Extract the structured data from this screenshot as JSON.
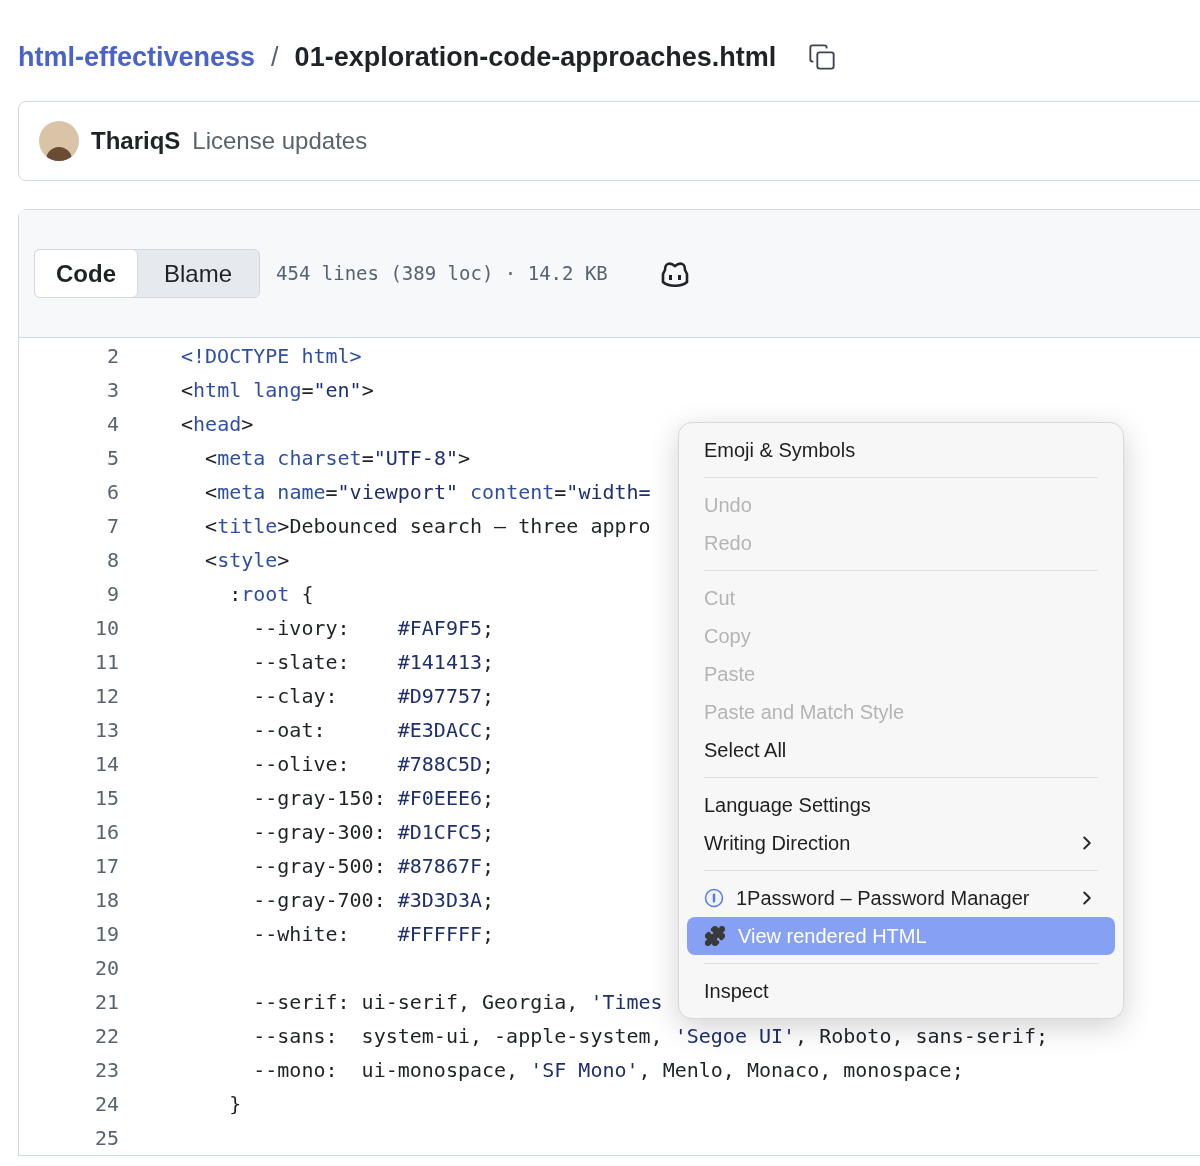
{
  "breadcrumb": {
    "repo": "html-effectiveness",
    "separator": "/",
    "file": "01-exploration-code-approaches.html"
  },
  "commit": {
    "author": "ThariqS",
    "message": "License updates"
  },
  "file_header": {
    "tabs": [
      {
        "label": "Code",
        "selected": true
      },
      {
        "label": "Blame",
        "selected": false
      }
    ],
    "info": "454 lines (389 loc) · 14.2 KB"
  },
  "code_lines": [
    {
      "number": "2",
      "tokens": [
        {
          "kind": "tag",
          "text": "<!DOCTYPE html>"
        }
      ]
    },
    {
      "number": "3",
      "tokens": [
        {
          "kind": "text",
          "text": "<"
        },
        {
          "kind": "tag",
          "text": "html"
        },
        {
          "kind": "attr",
          "text": " lang"
        },
        {
          "kind": "text",
          "text": "="
        },
        {
          "kind": "string",
          "text": "\"en\""
        },
        {
          "kind": "text",
          "text": ">"
        }
      ]
    },
    {
      "number": "4",
      "tokens": [
        {
          "kind": "text",
          "text": "<"
        },
        {
          "kind": "tag",
          "text": "head"
        },
        {
          "kind": "text",
          "text": ">"
        }
      ]
    },
    {
      "number": "5",
      "tokens": [
        {
          "kind": "text",
          "text": "  <"
        },
        {
          "kind": "tag",
          "text": "meta"
        },
        {
          "kind": "attr",
          "text": " charset"
        },
        {
          "kind": "text",
          "text": "="
        },
        {
          "kind": "string",
          "text": "\"UTF-8\""
        },
        {
          "kind": "text",
          "text": ">"
        }
      ]
    },
    {
      "number": "6",
      "tokens": [
        {
          "kind": "text",
          "text": "  <"
        },
        {
          "kind": "tag",
          "text": "meta"
        },
        {
          "kind": "attr",
          "text": " name"
        },
        {
          "kind": "text",
          "text": "="
        },
        {
          "kind": "string",
          "text": "\"viewport\""
        },
        {
          "kind": "attr",
          "text": " content"
        },
        {
          "kind": "text",
          "text": "="
        },
        {
          "kind": "string",
          "text": "\"width="
        }
      ]
    },
    {
      "number": "7",
      "tokens": [
        {
          "kind": "text",
          "text": "  <"
        },
        {
          "kind": "tag",
          "text": "title"
        },
        {
          "kind": "text",
          "text": ">Debounced search – three appro"
        }
      ]
    },
    {
      "number": "8",
      "tokens": [
        {
          "kind": "text",
          "text": "  <"
        },
        {
          "kind": "tag",
          "text": "style"
        },
        {
          "kind": "text",
          "text": ">"
        }
      ]
    },
    {
      "number": "9",
      "tokens": [
        {
          "kind": "text",
          "text": "    :"
        },
        {
          "kind": "tag",
          "text": "root"
        },
        {
          "kind": "text",
          "text": " {"
        }
      ]
    },
    {
      "number": "10",
      "tokens": [
        {
          "kind": "text",
          "text": "      --ivory:    "
        },
        {
          "kind": "string",
          "text": "#FAF9F5"
        },
        {
          "kind": "text",
          "text": ";"
        }
      ]
    },
    {
      "number": "11",
      "tokens": [
        {
          "kind": "text",
          "text": "      --slate:    "
        },
        {
          "kind": "string",
          "text": "#141413"
        },
        {
          "kind": "text",
          "text": ";"
        }
      ]
    },
    {
      "number": "12",
      "tokens": [
        {
          "kind": "text",
          "text": "      --clay:     "
        },
        {
          "kind": "string",
          "text": "#D97757"
        },
        {
          "kind": "text",
          "text": ";"
        }
      ]
    },
    {
      "number": "13",
      "tokens": [
        {
          "kind": "text",
          "text": "      --oat:      "
        },
        {
          "kind": "string",
          "text": "#E3DACC"
        },
        {
          "kind": "text",
          "text": ";"
        }
      ]
    },
    {
      "number": "14",
      "tokens": [
        {
          "kind": "text",
          "text": "      --olive:    "
        },
        {
          "kind": "string",
          "text": "#788C5D"
        },
        {
          "kind": "text",
          "text": ";"
        }
      ]
    },
    {
      "number": "15",
      "tokens": [
        {
          "kind": "text",
          "text": "      --gray-150: "
        },
        {
          "kind": "string",
          "text": "#F0EEE6"
        },
        {
          "kind": "text",
          "text": ";"
        }
      ]
    },
    {
      "number": "16",
      "tokens": [
        {
          "kind": "text",
          "text": "      --gray-300: "
        },
        {
          "kind": "string",
          "text": "#D1CFC5"
        },
        {
          "kind": "text",
          "text": ";"
        }
      ]
    },
    {
      "number": "17",
      "tokens": [
        {
          "kind": "text",
          "text": "      --gray-500: "
        },
        {
          "kind": "string",
          "text": "#87867F"
        },
        {
          "kind": "text",
          "text": ";"
        }
      ]
    },
    {
      "number": "18",
      "tokens": [
        {
          "kind": "text",
          "text": "      --gray-700: "
        },
        {
          "kind": "string",
          "text": "#3D3D3A"
        },
        {
          "kind": "text",
          "text": ";"
        }
      ]
    },
    {
      "number": "19",
      "tokens": [
        {
          "kind": "text",
          "text": "      --white:    "
        },
        {
          "kind": "string",
          "text": "#FFFFFF"
        },
        {
          "kind": "text",
          "text": ";"
        }
      ]
    },
    {
      "number": "20"
    },
    {
      "number": "21",
      "tokens": [
        {
          "kind": "text",
          "text": "      --serif: ui-serif, Georgia, "
        },
        {
          "kind": "string",
          "text": "'Times"
        }
      ]
    },
    {
      "number": "22",
      "tokens": [
        {
          "kind": "text",
          "text": "      --sans:  system-ui, -apple-system, "
        },
        {
          "kind": "string",
          "text": "'Segoe UI'"
        },
        {
          "kind": "text",
          "text": ", Roboto, sans-serif;"
        }
      ]
    },
    {
      "number": "23",
      "tokens": [
        {
          "kind": "text",
          "text": "      --mono:  ui-monospace, "
        },
        {
          "kind": "string",
          "text": "'SF Mono'"
        },
        {
          "kind": "text",
          "text": ", Menlo, Monaco, monospace;"
        }
      ]
    },
    {
      "number": "24",
      "tokens": [
        {
          "kind": "text",
          "text": "    }"
        }
      ]
    },
    {
      "number": "25"
    }
  ],
  "context_menu": {
    "groups": [
      [
        {
          "label": "Emoji & Symbols",
          "kind": "text",
          "disabled": false,
          "selected": false,
          "submenu": false
        }
      ],
      [
        {
          "label": "Undo",
          "kind": "text",
          "disabled": true,
          "selected": false,
          "submenu": false
        },
        {
          "label": "Redo",
          "kind": "text",
          "disabled": true,
          "selected": false,
          "submenu": false
        }
      ],
      [
        {
          "label": "Cut",
          "kind": "text",
          "disabled": true,
          "selected": false,
          "submenu": false
        },
        {
          "label": "Copy",
          "kind": "text",
          "disabled": true,
          "selected": false,
          "submenu": false
        },
        {
          "label": "Paste",
          "kind": "text",
          "disabled": true,
          "selected": false,
          "submenu": false
        },
        {
          "label": "Paste and Match Style",
          "kind": "text",
          "disabled": true,
          "selected": false,
          "submenu": false
        },
        {
          "label": "Select All",
          "kind": "text",
          "disabled": false,
          "selected": false,
          "submenu": false
        }
      ],
      [
        {
          "label": "Language Settings",
          "kind": "text",
          "disabled": false,
          "selected": false,
          "submenu": false
        },
        {
          "label": "Writing Direction",
          "kind": "text",
          "disabled": false,
          "selected": false,
          "submenu": true
        }
      ],
      [
        {
          "label": "1Password – Password Manager",
          "kind": "password",
          "disabled": false,
          "selected": false,
          "submenu": true
        },
        {
          "label": "View rendered HTML",
          "kind": "extension",
          "disabled": false,
          "selected": true,
          "submenu": false
        }
      ],
      [
        {
          "label": "Inspect",
          "kind": "text",
          "disabled": false,
          "selected": false,
          "submenu": false
        }
      ]
    ]
  }
}
